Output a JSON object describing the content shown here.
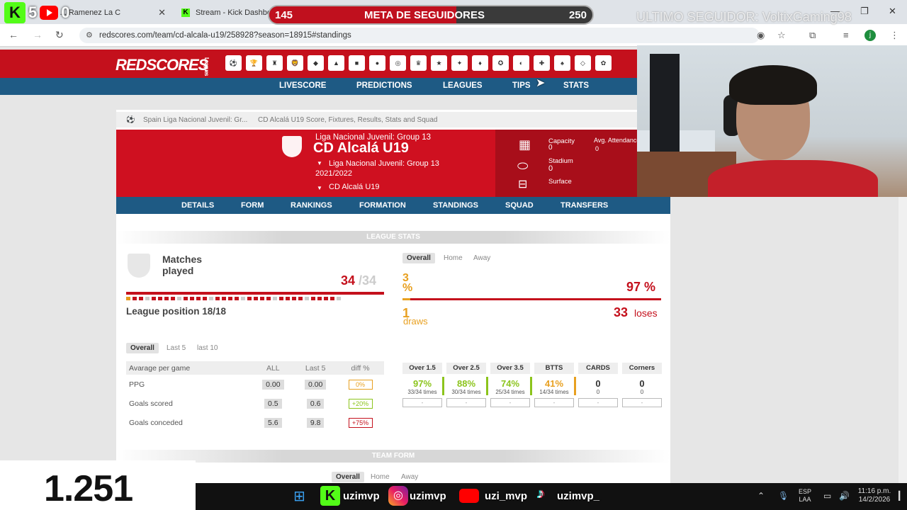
{
  "browser": {
    "tabs": [
      {
        "title": "(9) ... Ramenez La C"
      },
      {
        "title": "Stream - Kick Dashbo"
      }
    ],
    "url": "redscores.com/team/cd-alcala-u19/258928?season=18915#standings",
    "avatar_letter": "j"
  },
  "overlay": {
    "kick_count": "5",
    "youtube_count": "0",
    "goal_label": "META DE SEGUIDORES",
    "goal_current": "145",
    "goal_target": "250",
    "goal_progress": 0.58,
    "last_follower": "ULTIMO SEGUIDOR: VoltixGaming98",
    "viewer_total": "1.251",
    "socials": [
      "uzimvp",
      "uzimvp",
      "uzi_mvp",
      "uzimvp_"
    ]
  },
  "site": {
    "logo": "REDSCORES",
    "logo_sub": "Leagues",
    "nav": [
      "LIVESCORE",
      "PREDICTIONS",
      "LEAGUES",
      "TIPS",
      "STATS"
    ],
    "breadcrumb": [
      "Spain Liga Nacional Juvenil: Gr...",
      "CD Alcalá U19 Score, Fixtures, Results, Stats and Squad"
    ],
    "team": {
      "league": "Liga Nacional Juvenil: Group 13",
      "name": "CD Alcalá U19",
      "competition": "Liga Nacional Juvenil: Group 13",
      "season": "2021/2022",
      "team_select": "CD Alcalá U19",
      "capacity_label": "Capacity",
      "capacity": "0",
      "stadium_label": "Stadium",
      "stadium": "0",
      "surface_label": "Surface",
      "avg_att_label": "Avg. Attendance",
      "avg_att": "0"
    },
    "tabs": [
      "DETAILS",
      "FORM",
      "RANKINGS",
      "FORMATION",
      "STANDINGS",
      "SQUAD",
      "TRANSFERS"
    ],
    "league_stats": {
      "title": "LEAGUE STATS",
      "matches_label": "Matches played",
      "matches_played": "34",
      "matches_total": "/34",
      "position": "League position 18/18",
      "filters": [
        "Overall",
        "Home",
        "Away"
      ],
      "win_pct": "3 %",
      "lose_pct": "97 %",
      "draws_num": "1",
      "draws_label": "draws",
      "loses_num": "33",
      "loses_label": "loses"
    },
    "averages": {
      "filters": [
        "Overall",
        "Last 5",
        "last 10"
      ],
      "headers": [
        "Avarage per game",
        "ALL",
        "Last 5",
        "diff %"
      ],
      "rows": [
        {
          "label": "PPG",
          "all": "0.00",
          "last5": "0.00",
          "diff": "0%",
          "color": "#e8a020"
        },
        {
          "label": "Goals scored",
          "all": "0.5",
          "last5": "0.6",
          "diff": "+20%",
          "color": "#8cc41c"
        },
        {
          "label": "Goals conceded",
          "all": "5.6",
          "last5": "9.8",
          "diff": "+75%",
          "color": "#c4101c"
        }
      ]
    },
    "overs": [
      {
        "label": "Over 1.5",
        "pct": "97%",
        "times": "33/34 times",
        "color": "#8cc41c"
      },
      {
        "label": "Over 2.5",
        "pct": "88%",
        "times": "30/34 times",
        "color": "#8cc41c"
      },
      {
        "label": "Over 3.5",
        "pct": "74%",
        "times": "25/34 times",
        "color": "#8cc41c"
      },
      {
        "label": "BTTS",
        "pct": "41%",
        "times": "14/34 times",
        "color": "#e8a020"
      },
      {
        "label": "CARDS",
        "pct": "0",
        "times": "0",
        "color": "#333333"
      },
      {
        "label": "Corners",
        "pct": "0",
        "times": "0",
        "color": "#333333"
      }
    ],
    "team_form": {
      "title": "TEAM FORM",
      "filters": [
        "Overall",
        "Home",
        "Away"
      ]
    }
  },
  "taskbar": {
    "lang": "ESP",
    "lang2": "LAA",
    "time": "11:16 p.m.",
    "date": "14/2/2026"
  }
}
